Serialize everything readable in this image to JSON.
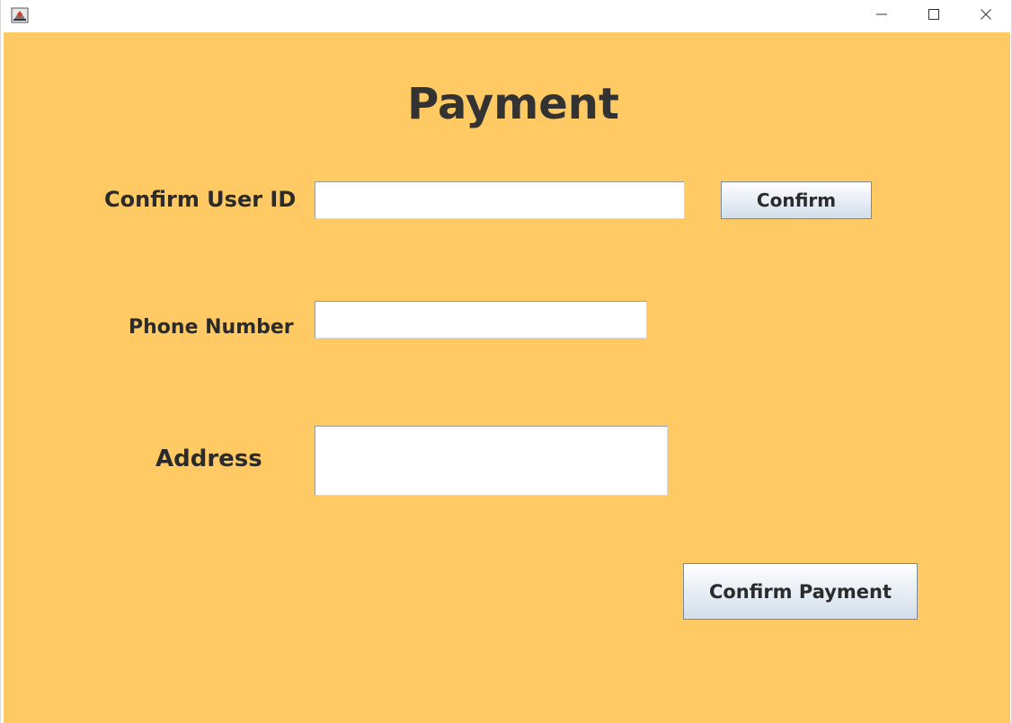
{
  "window": {
    "title_bar": {
      "icon": "java-app-icon",
      "controls": {
        "minimize": "minimize-icon",
        "maximize": "maximize-icon",
        "close": "close-icon"
      }
    }
  },
  "form": {
    "title": "Payment",
    "background_color": "#ffca63",
    "user_id": {
      "label": "Confirm User ID",
      "value": "",
      "confirm_button": "Confirm"
    },
    "phone": {
      "label": "Phone Number",
      "value": ""
    },
    "address": {
      "label": "Address",
      "value": ""
    },
    "submit_button": "Confirm Payment"
  }
}
